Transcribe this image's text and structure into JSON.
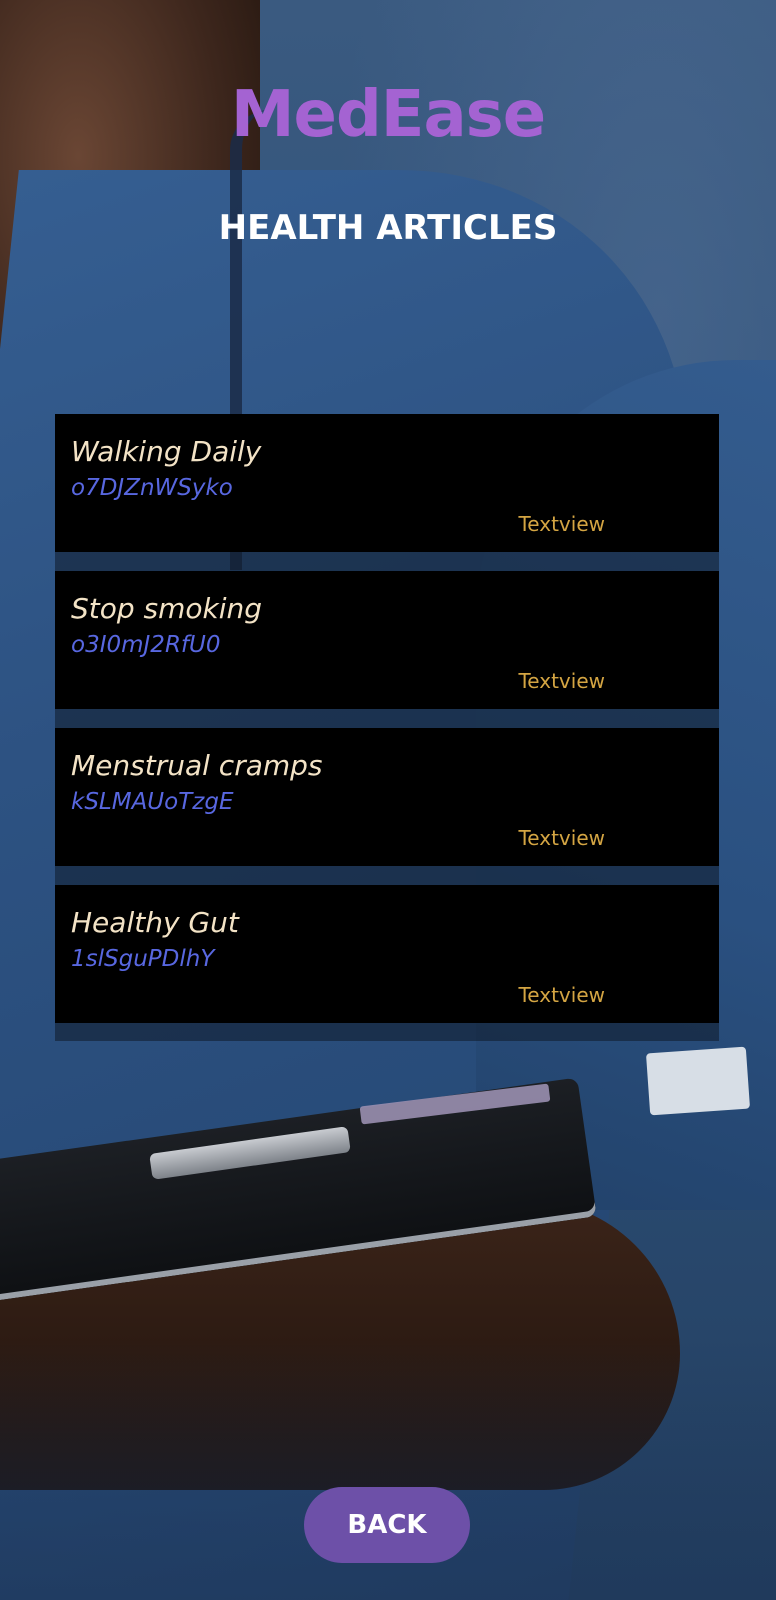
{
  "app": {
    "title": "MedEase"
  },
  "header": {
    "title": "HEALTH ARTICLES"
  },
  "articles": [
    {
      "title": "Walking Daily",
      "id": "o7DJZnWSyko",
      "link_label": "Textview"
    },
    {
      "title": "Stop smoking",
      "id": "o3I0mJ2RfU0",
      "link_label": "Textview"
    },
    {
      "title": "Menstrual cramps",
      "id": "kSLMAUoTzgE",
      "link_label": "Textview"
    },
    {
      "title": "Healthy Gut",
      "id": "1slSguPDlhY",
      "link_label": "Textview"
    }
  ],
  "footer": {
    "back_label": "BACK"
  },
  "colors": {
    "app_title": "#a463d2",
    "card_bg": "#000000",
    "card_title": "#f3e3c6",
    "card_id": "#5867e0",
    "card_link": "#d4a543",
    "button_bg": "#6d50a8"
  }
}
